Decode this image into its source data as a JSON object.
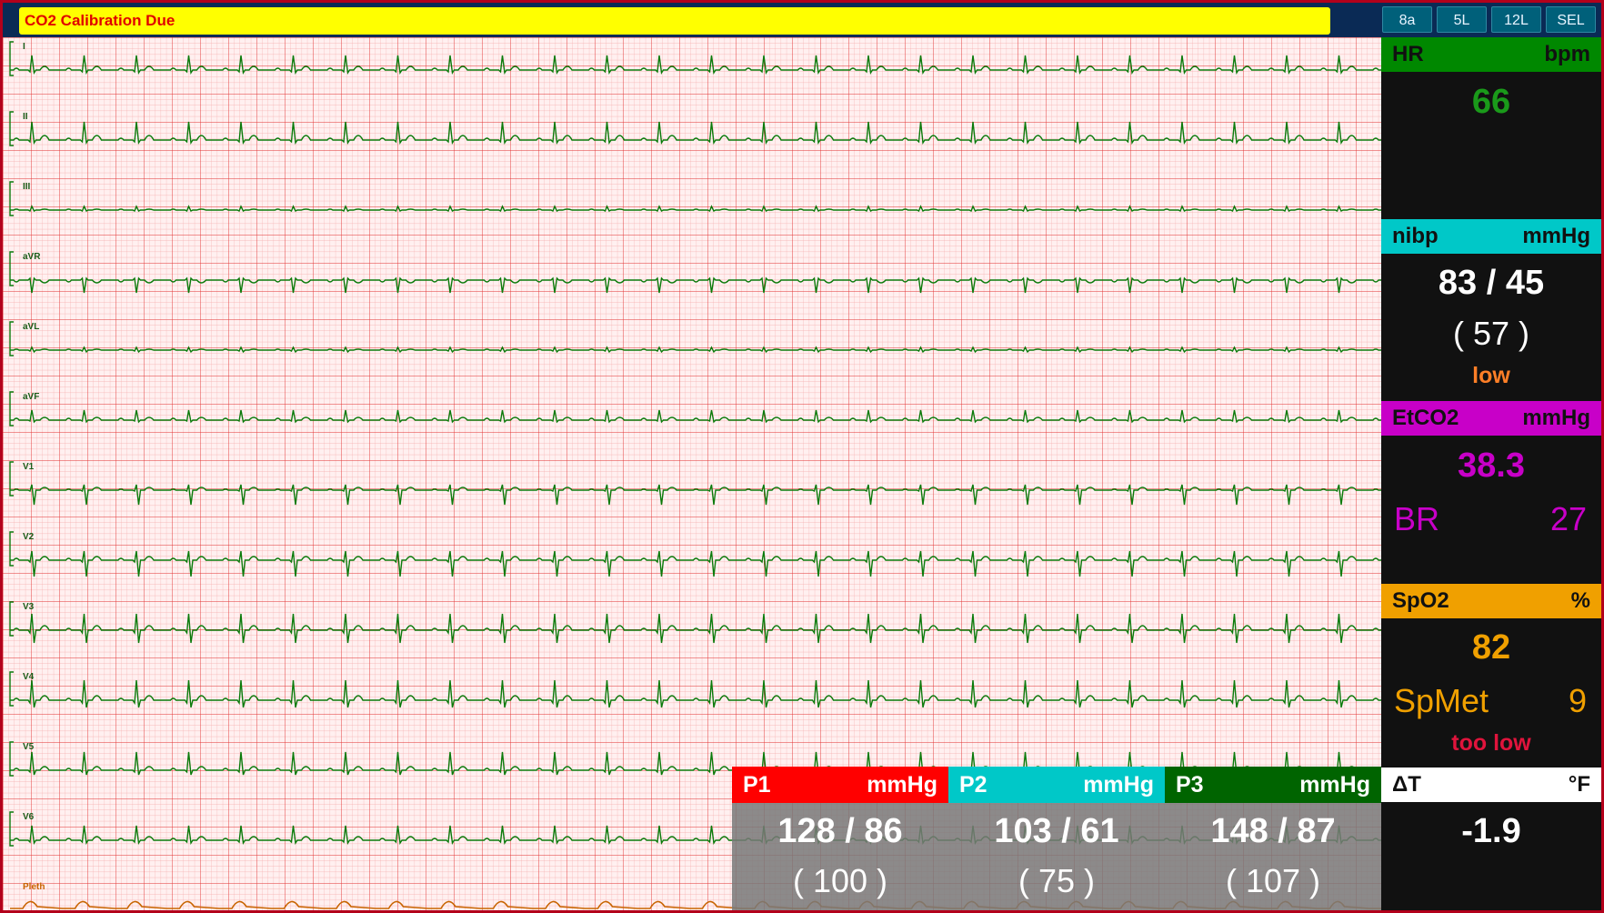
{
  "alarm": {
    "text": "CO2 Calibration Due"
  },
  "lead_buttons": [
    "8a",
    "5L",
    "12L",
    "SEL"
  ],
  "leads": [
    "I",
    "II",
    "III",
    "aVR",
    "aVL",
    "aVF",
    "V1",
    "V2",
    "V3",
    "V4",
    "V5",
    "V6"
  ],
  "pleth_label": "Pleth",
  "panels": {
    "hr": {
      "label": "HR",
      "unit": "bpm",
      "value": "66",
      "color": "#008800",
      "value_color": "#1a9a1a"
    },
    "nibp": {
      "label": "nibp",
      "unit": "mmHg",
      "value": "83 / 45",
      "mean": "( 57 )",
      "status": "low",
      "color": "#00c8c8"
    },
    "etco2": {
      "label": "EtCO2",
      "unit": "mmHg",
      "value": "38.3",
      "sub_label": "BR",
      "sub_value": "27",
      "color": "#c800c8"
    },
    "spo2": {
      "label": "SpO2",
      "unit": "%",
      "value": "82",
      "sub_label": "SpMet",
      "sub_value": "9",
      "status": "too low",
      "color": "#f0a000"
    },
    "dt": {
      "label": "ΔT",
      "unit": "°F",
      "value": "-1.9"
    }
  },
  "pressures": [
    {
      "label": "P1",
      "unit": "mmHg",
      "value": "128 / 86",
      "mean": "( 100 )",
      "color": "#ff0000"
    },
    {
      "label": "P2",
      "unit": "mmHg",
      "value": "103 / 61",
      "mean": "( 75 )",
      "color": "#00c8c8"
    },
    {
      "label": "P3",
      "unit": "mmHg",
      "value": "148 / 87",
      "mean": "( 107 )",
      "color": "#006400"
    }
  ],
  "colors": {
    "grid_bg": "#fff0f0",
    "grid_minor": "#f5a8a8",
    "grid_major": "#e23030",
    "ecg_trace": "#0a7a0a",
    "pleth_trace": "#c86400"
  }
}
